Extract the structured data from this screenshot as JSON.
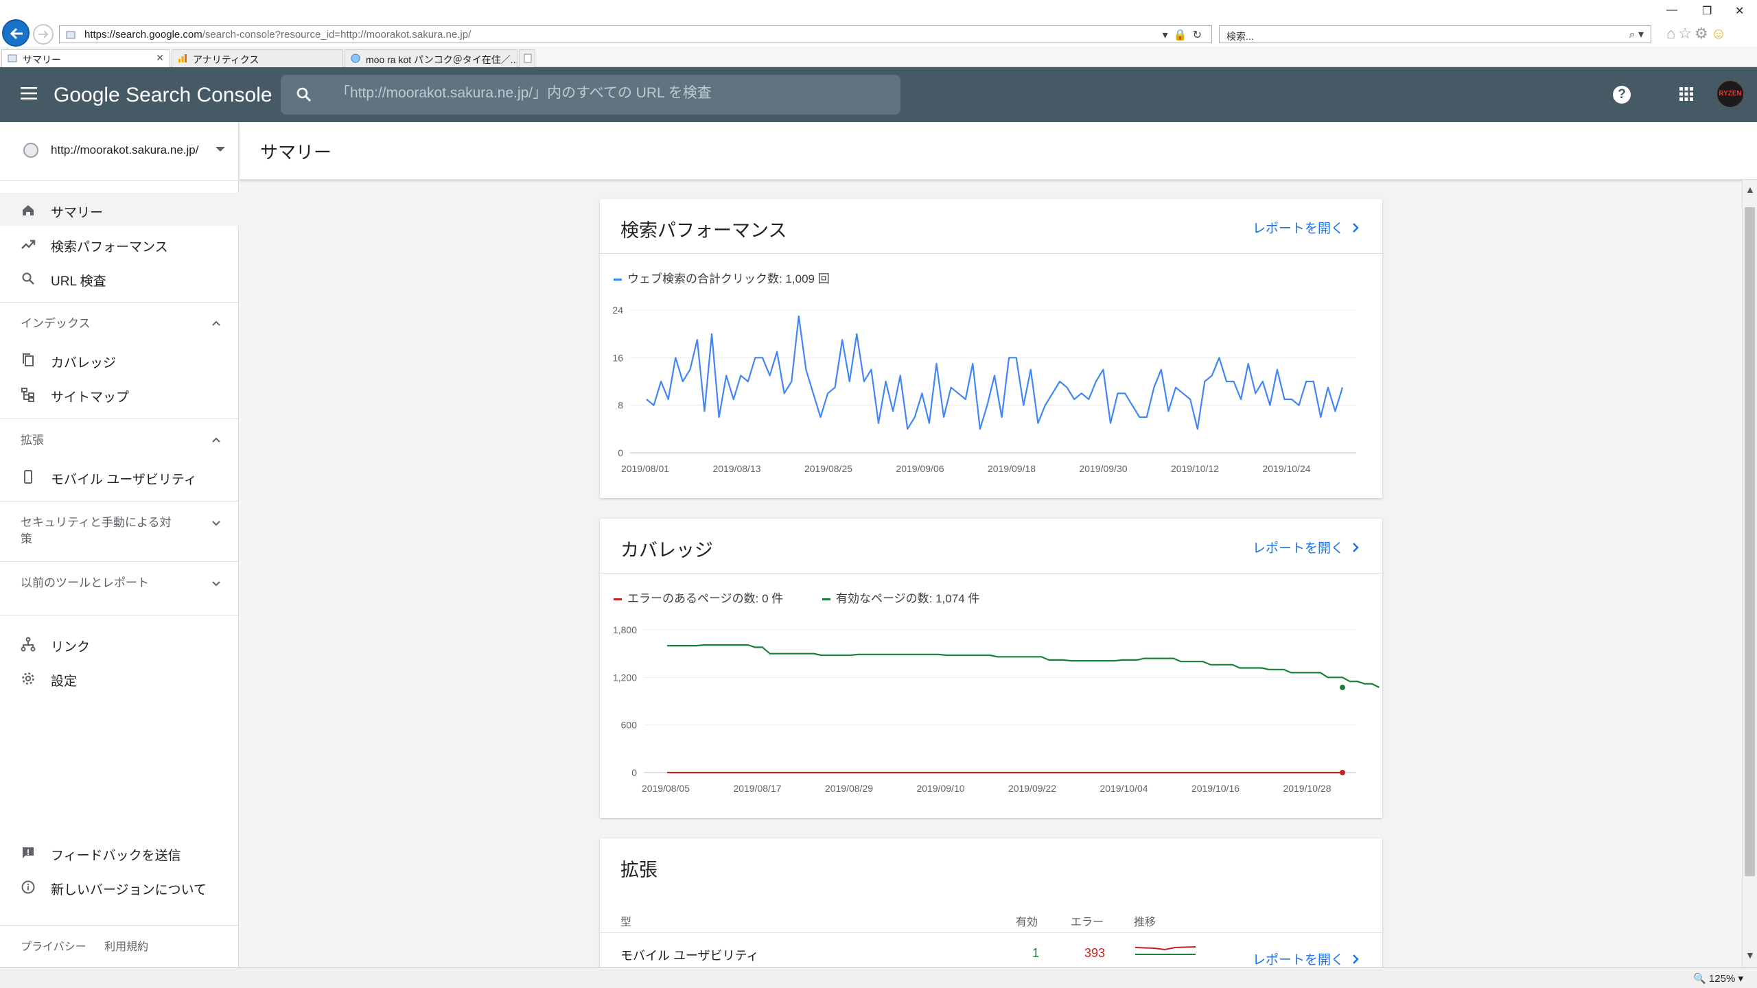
{
  "browser": {
    "address": {
      "host": "https://search.google.com",
      "path": "/search-console?resource_id=http://moorakot.sakura.ne.jp/"
    },
    "search_placeholder": "検索...",
    "tabs": [
      {
        "label": "サマリー",
        "active": true
      },
      {
        "label": "アナリティクス",
        "active": false
      },
      {
        "label": "moo ra kot パンコク＠タイ在住／...",
        "active": false
      }
    ],
    "zoom": "125%"
  },
  "header": {
    "logo_google": "Google",
    "logo_product": "Search Console",
    "search_placeholder": "「http://moorakot.sakura.ne.jp/」内のすべての URL を検査",
    "avatar_text": "RYZEN"
  },
  "sidebar": {
    "property": "http://moorakot.sakura.ne.jp/",
    "main_items": [
      {
        "label": "サマリー",
        "icon": "home-icon",
        "active": true
      },
      {
        "label": "検索パフォーマンス",
        "icon": "trending-up-icon",
        "active": false
      },
      {
        "label": "URL 検査",
        "icon": "search-icon",
        "active": false
      }
    ],
    "sections": {
      "index": {
        "label": "インデックス",
        "items": [
          "カバレッジ",
          "サイトマップ"
        ]
      },
      "enhancements": {
        "label": "拡張",
        "items": [
          "モバイル ユーザビリティ"
        ]
      },
      "security": {
        "label": "セキュリティと手動による対策"
      },
      "legacy": {
        "label": "以前のツールとレポート"
      }
    },
    "bottom_items": [
      "リンク",
      "設定"
    ],
    "feedback": "フィードバックを送信",
    "new_version": "新しいバージョンについて",
    "footer": [
      "プライバシー",
      "利用規約"
    ]
  },
  "page": {
    "title": "サマリー",
    "open_report": "レポートを開く"
  },
  "performance_card": {
    "title": "検索パフォーマンス",
    "legend": "ウェブ検索の合計クリック数: 1,009 回"
  },
  "coverage_card": {
    "title": "カバレッジ",
    "legend_error": "エラーのあるページの数: 0 件",
    "legend_valid": "有効なページの数: 1,074 件"
  },
  "enhancements_card": {
    "title": "拡張",
    "columns": {
      "type": "型",
      "valid": "有効",
      "error": "エラー",
      "trend": "推移"
    },
    "rows": [
      {
        "name": "モバイル ユーザビリティ",
        "valid": "1",
        "error": "393"
      }
    ]
  },
  "colors": {
    "header_bg": "#455a64",
    "clicks_line": "#4285f4",
    "error_line": "#c5221f",
    "valid_line": "#188038",
    "link": "#1a73e8"
  },
  "chart_data": [
    {
      "type": "line",
      "title": "",
      "series": [
        {
          "name": "ウェブ検索の合計クリック数",
          "values": [
            9,
            8,
            12,
            9,
            16,
            12,
            14,
            19,
            7,
            20,
            6,
            13,
            9,
            13,
            12,
            16,
            16,
            13,
            17,
            10,
            12,
            23,
            14,
            10,
            6,
            10,
            11,
            19,
            12,
            20,
            12,
            14,
            5,
            12,
            7,
            13,
            4,
            6,
            10,
            5,
            15,
            6,
            11,
            10,
            9,
            15,
            4,
            8,
            13,
            6,
            16,
            16,
            8,
            14,
            5,
            8,
            10,
            12,
            11,
            9,
            10,
            9,
            12,
            14,
            5,
            10,
            10,
            8,
            6,
            6,
            11,
            14,
            7,
            11,
            10,
            9,
            4,
            12,
            13,
            16,
            12,
            12,
            9,
            15,
            10,
            12,
            8,
            14,
            9,
            9,
            8,
            12,
            12,
            6,
            11,
            7,
            11
          ]
        }
      ],
      "x_start": "2019/08/01",
      "x_end": "2019/11/05",
      "x_ticks": [
        "2019/08/01",
        "2019/08/13",
        "2019/08/25",
        "2019/09/06",
        "2019/09/18",
        "2019/09/30",
        "2019/10/12",
        "2019/10/24"
      ],
      "y_ticks": [
        "0",
        "8",
        "16",
        "24"
      ],
      "ylim": [
        0,
        24
      ]
    },
    {
      "type": "line",
      "title": "",
      "series": [
        {
          "name": "エラーのあるページの数",
          "values": [
            0,
            0,
            0,
            0,
            0,
            0,
            0,
            0,
            0,
            0,
            0,
            0,
            0,
            0,
            0,
            0,
            0,
            0,
            0,
            0,
            0,
            0,
            0,
            0,
            0,
            0,
            0,
            0,
            0,
            0,
            0,
            0,
            0,
            0,
            0,
            0,
            0,
            0,
            0,
            0,
            0,
            0,
            0,
            0,
            0,
            0,
            0,
            0,
            0,
            0,
            0,
            0,
            0,
            0,
            0,
            0,
            0,
            0,
            0,
            0,
            0,
            0,
            0,
            0,
            0,
            0,
            0,
            0,
            0,
            0,
            0,
            0,
            0,
            0,
            0,
            0,
            0,
            0,
            0,
            0,
            0,
            0,
            0,
            0,
            0,
            0,
            0,
            0,
            0,
            0,
            0,
            0,
            0
          ]
        },
        {
          "name": "有効なページの数",
          "values": [
            1600,
            1600,
            1600,
            1600,
            1600,
            1610,
            1610,
            1610,
            1610,
            1610,
            1610,
            1610,
            1580,
            1580,
            1500,
            1500,
            1500,
            1500,
            1500,
            1500,
            1500,
            1480,
            1480,
            1480,
            1480,
            1480,
            1490,
            1490,
            1490,
            1490,
            1490,
            1490,
            1490,
            1490,
            1490,
            1490,
            1490,
            1490,
            1480,
            1480,
            1480,
            1480,
            1480,
            1480,
            1480,
            1460,
            1460,
            1460,
            1460,
            1460,
            1460,
            1460,
            1420,
            1420,
            1420,
            1410,
            1410,
            1410,
            1410,
            1410,
            1410,
            1410,
            1420,
            1420,
            1420,
            1440,
            1440,
            1440,
            1440,
            1440,
            1400,
            1400,
            1400,
            1400,
            1360,
            1360,
            1360,
            1360,
            1320,
            1320,
            1320,
            1320,
            1300,
            1300,
            1300,
            1260,
            1260,
            1260,
            1260,
            1260,
            1200,
            1200,
            1200,
            1150,
            1150,
            1120,
            1120,
            1074
          ]
        }
      ],
      "x_start": "2019/08/05",
      "x_end": "2019/11/05",
      "x_ticks": [
        "2019/08/05",
        "2019/08/17",
        "2019/08/29",
        "2019/09/10",
        "2019/09/22",
        "2019/10/04",
        "2019/10/16",
        "2019/10/28"
      ],
      "y_ticks": [
        "0",
        "600",
        "1,200",
        "1,800"
      ],
      "ylim": [
        0,
        1800
      ]
    }
  ]
}
